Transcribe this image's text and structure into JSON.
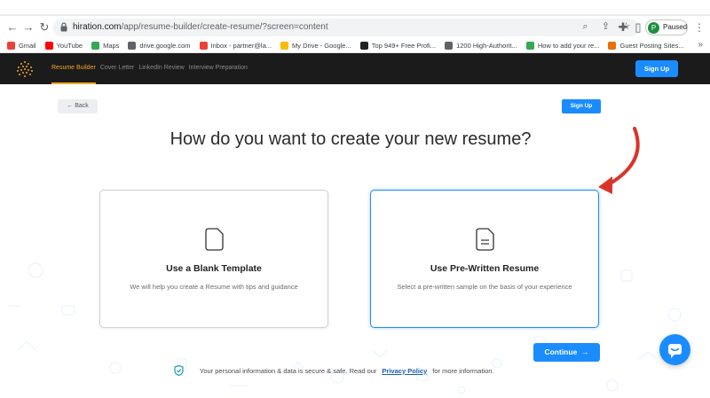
{
  "browser": {
    "url_host": "hiration.com",
    "url_path": "/app/resume-builder/create-resume/?screen=content",
    "profile_initial": "P",
    "profile_label": "Paused"
  },
  "bookmarks": [
    {
      "label": "Gmail",
      "color": "#ea4335"
    },
    {
      "label": "YouTube",
      "color": "#ff0000"
    },
    {
      "label": "Maps",
      "color": "#34a853"
    },
    {
      "label": "drive.google.com",
      "color": "#5f6368"
    },
    {
      "label": "Inbox - partner@la...",
      "color": "#ea4335"
    },
    {
      "label": "My Drive - Google...",
      "color": "#fbbc04"
    },
    {
      "label": "Top 949+ Free Profi...",
      "color": "#202124"
    },
    {
      "label": "1200 High-Authorit...",
      "color": "#5f6368"
    },
    {
      "label": "How to add your re...",
      "color": "#34a853"
    },
    {
      "label": "Guest Posting Sites...",
      "color": "#e8710a"
    }
  ],
  "app": {
    "nav": [
      "Resume Builder",
      "Cover Letter",
      "LinkedIn Review",
      "Interview Preparation"
    ],
    "signup_label": "Sign Up"
  },
  "page": {
    "back_label": "Back",
    "signup_label": "Sign Up",
    "heading": "How do you want to create your new resume?",
    "cards": [
      {
        "title": "Use a Blank Template",
        "subtitle": "We will help you create a Resume with tips and guidance",
        "icon": "blank-document-icon"
      },
      {
        "title": "Use Pre-Written Resume",
        "subtitle": "Select a pre-written sample on the basis of your experience",
        "icon": "text-document-icon"
      }
    ],
    "continue_label": "Continue",
    "continue_arrow": "→",
    "privacy_prefix": "Your personal information & data is secure & safe. Read our",
    "privacy_link": "Privacy Policy",
    "privacy_suffix": "for more information."
  },
  "colors": {
    "primary": "#1a8cff",
    "accent": "#f5a623",
    "appbar": "#1b1b1b",
    "annotation_arrow": "#d9342b"
  }
}
